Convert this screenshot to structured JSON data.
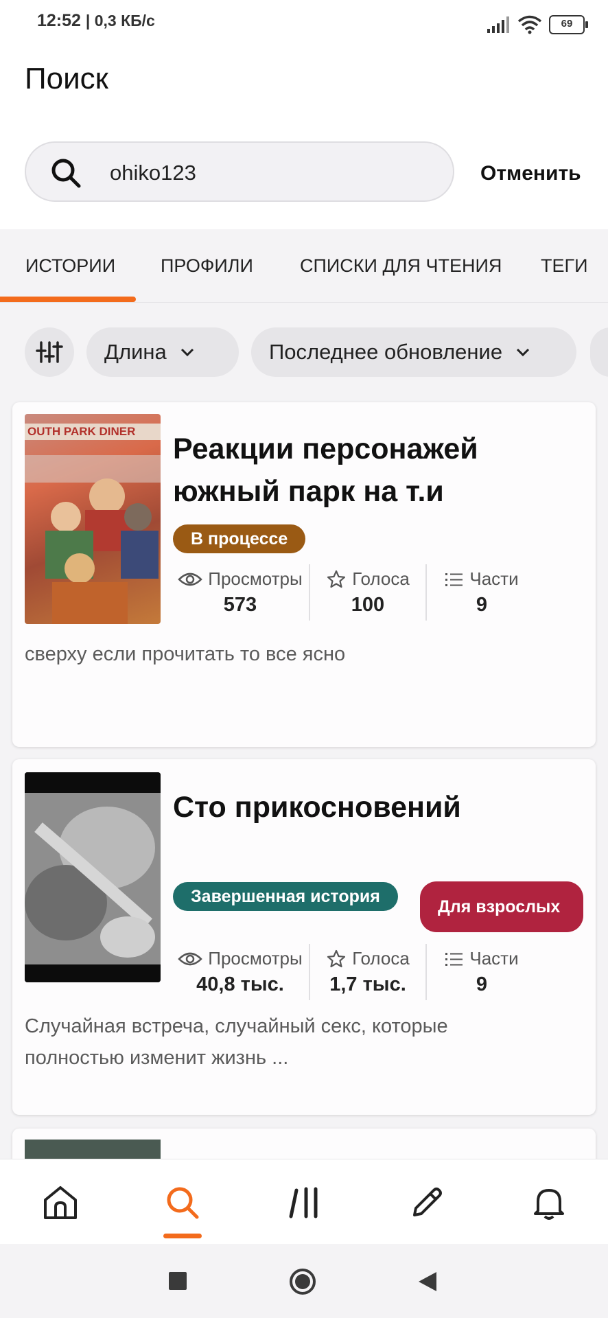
{
  "status_bar": {
    "time": "12:52",
    "speed": "| 0,3 КБ/с",
    "battery": "69"
  },
  "header": {
    "title": "Поиск"
  },
  "search": {
    "value": "ohiko123",
    "cancel_label": "Отменить"
  },
  "tabs": [
    {
      "label": "ИСТОРИИ",
      "active": true
    },
    {
      "label": "ПРОФИЛИ",
      "active": false
    },
    {
      "label": "СПИСКИ ДЛЯ ЧТЕНИЯ",
      "active": false
    },
    {
      "label": "ТЕГИ",
      "active": false
    }
  ],
  "filters": {
    "settings_icon": "sliders-icon",
    "chips": [
      {
        "label": "Длина"
      },
      {
        "label": "Последнее обновление"
      }
    ]
  },
  "stories": [
    {
      "title": "Реакции персонажей южный парк на т.и",
      "badges": [
        {
          "label": "В процессе",
          "color": "#9a5a14"
        }
      ],
      "stats": {
        "views_label": "Просмотры",
        "views": "573",
        "votes_label": "Голоса",
        "votes": "100",
        "parts_label": "Части",
        "parts": "9"
      },
      "cover_text": "OUTH PARK DINER",
      "description": "сверху если прочитать то все ясно"
    },
    {
      "title": "Сто прикосновений",
      "badges": [
        {
          "label": "Завершенная история",
          "color": "#1e6e6a"
        },
        {
          "label": "Для взрослых",
          "color": "#b0233f"
        }
      ],
      "stats": {
        "views_label": "Просмотры",
        "views": "40,8 тыс.",
        "votes_label": "Голоса",
        "votes": "1,7 тыс.",
        "parts_label": "Части",
        "parts": "9"
      },
      "description": "Случайная встреча, случайный секс, которые полностью изменит жизнь ..."
    }
  ],
  "bottom_nav": [
    {
      "icon": "home-icon"
    },
    {
      "icon": "search-icon",
      "active": true
    },
    {
      "icon": "library-icon"
    },
    {
      "icon": "pencil-icon"
    },
    {
      "icon": "bell-icon"
    }
  ],
  "colors": {
    "accent": "#f36b1c"
  }
}
